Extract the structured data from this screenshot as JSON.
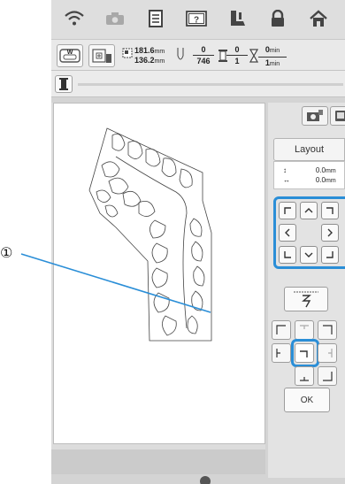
{
  "callout": {
    "number": "①"
  },
  "info": {
    "width": "181.6",
    "height": "136.2",
    "unit_mm": "mm",
    "stitch_cur": "0",
    "stitch_total": "746",
    "color_cur": "0",
    "color_total": "1",
    "time_cur": "0",
    "time_unit": "min",
    "time_total": "1"
  },
  "progress": {
    "fraction": 0.0
  },
  "panel": {
    "layout_tab": "Layout",
    "offset_v": "0.0",
    "offset_h": "0.0",
    "offset_unit": "mm",
    "ok_label": "OK"
  },
  "colors": {
    "accent": "#2a8ed7",
    "pattern_line": "#444444"
  }
}
